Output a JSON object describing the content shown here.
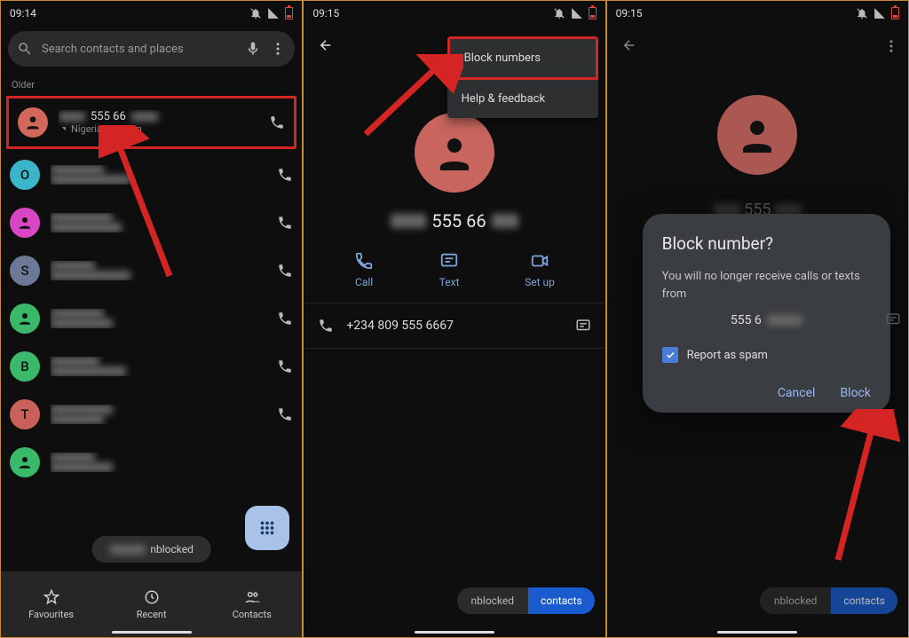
{
  "panel1": {
    "time": "09:14",
    "search_placeholder": "Search contacts and places",
    "section": "Older",
    "first_call": {
      "num_partial": "555 66",
      "sub_loc": "Nigeria",
      "sub_sep": "•",
      "sub_date": "16 Jan"
    },
    "avatars": [
      "O",
      "",
      "S",
      "",
      "B",
      "T",
      "",
      ""
    ],
    "toast": "nblocked",
    "nav": {
      "fav": "Favourites",
      "recent": "Recent",
      "contacts": "Contacts"
    }
  },
  "panel2": {
    "time": "09:15",
    "menu": {
      "block": "Block numbers",
      "help": "Help & feedback"
    },
    "num_partial": "555 66",
    "actions": {
      "call": "Call",
      "text": "Text",
      "setup": "Set up"
    },
    "detail_num": "+234 809 555 6667",
    "chip": {
      "dark": "nblocked",
      "blue": "contacts"
    }
  },
  "panel3": {
    "time": "09:15",
    "faint_num": "555",
    "dialog": {
      "title": "Block number?",
      "body": "You will no longer receive calls or texts from",
      "num_partial": "555 6",
      "report": "Report as spam",
      "cancel": "Cancel",
      "block": "Block"
    },
    "chip": {
      "dark": "nblocked",
      "blue": "contacts"
    }
  }
}
